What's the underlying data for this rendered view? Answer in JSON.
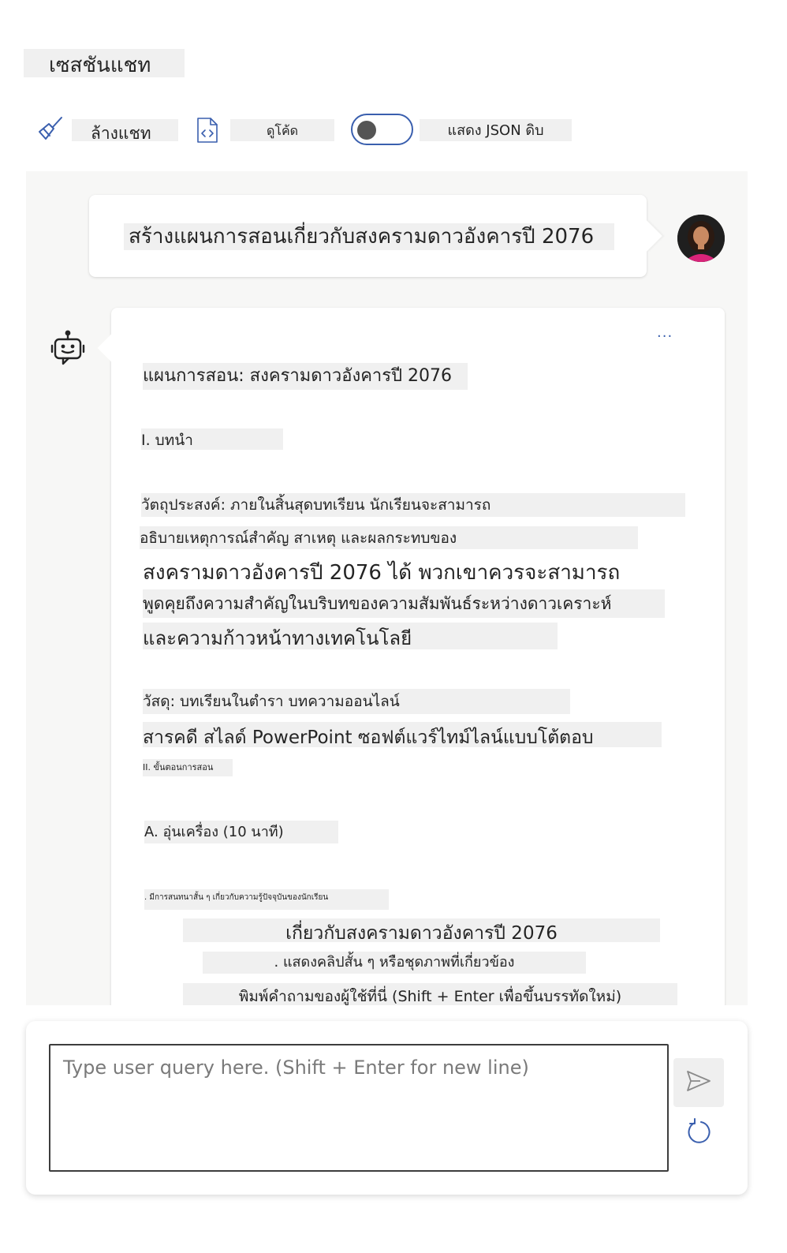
{
  "page": {
    "title": "เซสชันแชท"
  },
  "toolbar": {
    "clear_label": "ล้างแชท",
    "view_code_label": "ดูโค้ด",
    "raw_json_label": "แสดง JSON ดิบ",
    "raw_json_enabled": false
  },
  "conversation": {
    "user_message": "สร้างแผนการสอนเกี่ยวกับสงครามดาวอังคารปี 2076",
    "assistant_more_label": "···",
    "assistant_lines": [
      "แผนการสอน: สงครามดาวอังคารปี 2076",
      "I. บทนำ",
      "วัตถุประสงค์: ภายในสิ้นสุดบทเรียน นักเรียนจะสามารถ",
      "อธิบายเหตุการณ์สำคัญ สาเหตุ และผลกระทบของ",
      "สงครามดาวอังคารปี 2076 ได้ พวกเขาควรจะสามารถ",
      "พูดคุยถึงความสำคัญในบริบทของความสัมพันธ์ระหว่างดาวเคราะห์",
      "และความก้าวหน้าทางเทคโนโลยี",
      "วัสดุ: บทเรียนในตำรา บทความออนไลน์",
      "สารคดี สไลด์ PowerPoint ซอฟต์แวร์ไทม์ไลน์แบบโต้ตอบ",
      "II. ขั้นตอนการสอน",
      "A. อุ่นเครื่อง (10 นาที)",
      ". มีการสนทนาสั้น ๆ เกี่ยวกับความรู้ปัจจุบันของนักเรียน",
      "เกี่ยวกับสงครามดาวอังคารปี 2076",
      ". แสดงคลิปสั้น ๆ หรือชุดภาพที่เกี่ยวข้อง",
      "พิมพ์คำถามของผู้ใช้ที่นี่ (Shift + Enter เพื่อขึ้นบรรทัดใหม่)"
    ]
  },
  "composer": {
    "placeholder": "Type user query here. (Shift + Enter for new line)",
    "send_icon": "send-icon",
    "reset_icon": "refresh-icon"
  },
  "colors": {
    "accent": "#3a5fae",
    "chat_background": "#f7f7f6",
    "highlight": "#f0f0f0"
  }
}
